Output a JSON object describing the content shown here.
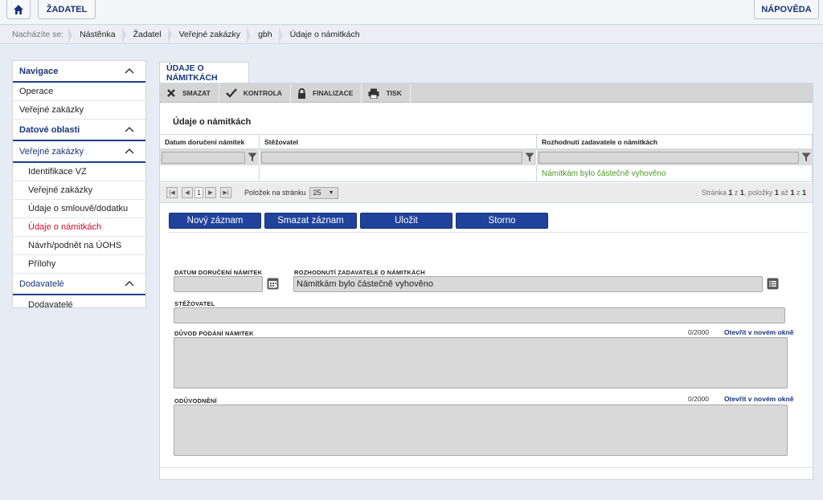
{
  "topbar": {
    "home_icon": "home-icon",
    "zadatel_label": "ŽADATEL",
    "napoveda_label": "NÁPOVĚDA"
  },
  "breadcrumb": {
    "prefix": "Nacházíte se:",
    "items": [
      "Nástěnka",
      "Žadatel",
      "Veřejné zakázky",
      "gbh",
      "Údaje o námitkách"
    ]
  },
  "sidebar": {
    "nav_header": "Navigace",
    "nav_items": [
      "Operace",
      "Veřejné zakázky"
    ],
    "data_header": "Datové oblasti",
    "vz_header": "Veřejné zakázky",
    "vz_items": [
      "Identifikace VZ",
      "Veřejné zakázky",
      "Údaje o smlouvě/dodatku",
      "Údaje o námitkách",
      "Návrh/podnět na ÚOHS",
      "Přílohy"
    ],
    "dod_header": "Dodavatelé",
    "dod_items": [
      "Dodavatelé"
    ]
  },
  "main": {
    "tab_label": "ÚDAJE O NÁMITKÁCH",
    "toolbar": {
      "smazat": "SMAZAT",
      "kontrola": "KONTROLA",
      "finalizace": "FINALIZACE",
      "tisk": "TISK"
    },
    "section_title": "Údaje o námitkách",
    "grid": {
      "columns": [
        "Datum doručení námitek",
        "Stěžovatel",
        "Rozhodnutí zadavatele o námitkách"
      ],
      "rows": [
        [
          "",
          "",
          "Námitkám bylo částečně vyhověno"
        ]
      ]
    },
    "pager": {
      "page": "1",
      "per_page_label": "Položek na stránku",
      "per_page_value": "25",
      "info_prefix": "Stránka ",
      "info_page": "1",
      "info_z": " z ",
      "info_pages": "1",
      "info_items": ", položky ",
      "info_from": "1",
      "info_az": " až ",
      "info_to": "1",
      "info_z2": " z ",
      "info_total": "1"
    },
    "buttons": {
      "novy": "Nový záznam",
      "smazat": "Smazat záznam",
      "ulozit": "Uložit",
      "storno": "Storno"
    },
    "form": {
      "datum_label": "DATUM DORUČENÍ NÁMITEK",
      "datum_value": "",
      "rozhodnuti_label": "ROZHODNUTÍ ZADAVATELE O NÁMITKÁCH",
      "rozhodnuti_value": "Námitkám bylo částečně vyhověno",
      "stezovatel_label": "STĚŽOVATEL",
      "stezovatel_value": "",
      "duvod_label": "DŮVOD PODÁNÍ NÁMITEK",
      "duvod_counter": "0/2000",
      "duvod_link": "Otevřít v novém okně",
      "oduvodneni_label": "ODŮVODNĚNÍ",
      "oduvodneni_counter": "0/2000",
      "oduvodneni_link": "Otevřít v novém okně"
    }
  }
}
